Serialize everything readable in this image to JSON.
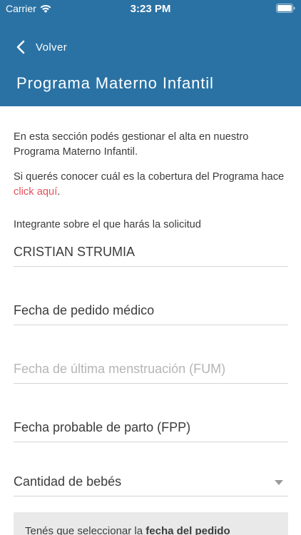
{
  "status_bar": {
    "carrier": "Carrier",
    "time": "3:23 PM",
    "icons": [
      "wifi-icon",
      "battery-icon"
    ]
  },
  "nav": {
    "back_label": "Volver",
    "back_icon": "chevron-left-icon",
    "title": "Programa Materno Infantil"
  },
  "intro": {
    "paragraph1": "En esta sección podés gestionar el alta en nuestro Programa Materno Infantil.",
    "paragraph2_prefix": "Si querés conocer cuál es la cobertura del Programa hace ",
    "paragraph2_link": "click aquí",
    "paragraph2_suffix": "."
  },
  "form": {
    "member_label": "Integrante sobre el que harás la solicitud",
    "member_value": "CRISTIAN STRUMIA",
    "medical_order_date": "Fecha de pedido médico",
    "last_period_date_placeholder": "Fecha de última menstruación (FUM)",
    "probable_delivery_date": "Fecha probable de parto (FPP)",
    "babies_count": "Cantidad de bebés"
  },
  "notice": {
    "text_prefix": "Tenés que seleccionar la ",
    "text_bold": "fecha del pedido"
  },
  "colors": {
    "header_bg": "#2a72a4",
    "link": "#e8505b",
    "text": "#3b3b3b",
    "placeholder": "#b5b5b5",
    "notice_bg": "#e9e9e9"
  }
}
